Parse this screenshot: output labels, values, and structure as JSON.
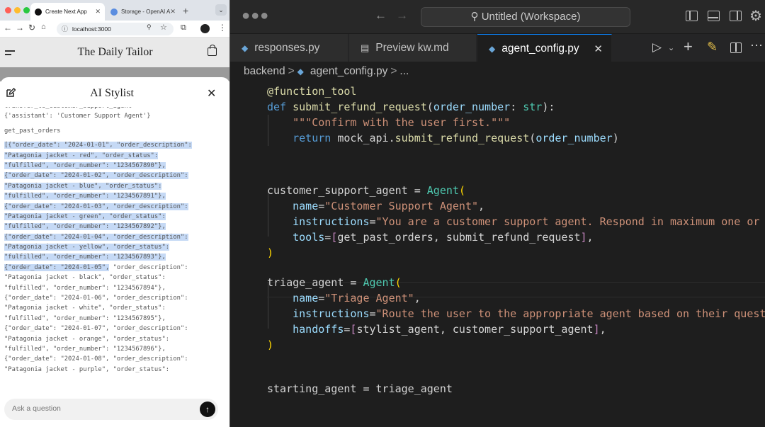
{
  "browser": {
    "tabs": [
      {
        "label": "Create Next App",
        "active": true
      },
      {
        "label": "Storage - OpenAI A",
        "active": false
      }
    ],
    "url": "localhost:3000",
    "site_title": "The Daily Tailor",
    "chat": {
      "title": "AI Stylist",
      "log": [
        {
          "text": "transfer_to_customer_support_agent",
          "cutoff": true
        },
        {
          "text": "{'assistant': 'Customer Support Agent'}"
        },
        {
          "gap": true
        },
        {
          "text": "get_past_orders"
        },
        {
          "gap": true
        },
        {
          "sel": "[{\"order_date\": \"2024-01-01\", \"order_description\":",
          "full": true
        },
        {
          "sel": "\"Patagonia jacket - red\", \"order_status\":",
          "full": true
        },
        {
          "sel": "\"fulfilled\", \"order_number\": \"1234567890\"},",
          "full": true
        },
        {
          "sel": "{\"order_date\": \"2024-01-02\", \"order_description\":",
          "full": true
        },
        {
          "sel": "\"Patagonia jacket - blue\", \"order_status\":",
          "full": true
        },
        {
          "sel": "\"fulfilled\", \"order_number\": \"1234567891\"},",
          "full": true
        },
        {
          "sel": "{\"order_date\": \"2024-01-03\", \"order_description\":",
          "full": true
        },
        {
          "sel": "\"Patagonia jacket - green\", \"order_status\":",
          "full": true
        },
        {
          "sel": "\"fulfilled\", \"order_number\": \"1234567892\"},",
          "full": true
        },
        {
          "sel": "{\"order_date\": \"2024-01-04\", \"order_description\":",
          "full": true
        },
        {
          "sel": "\"Patagonia jacket - yellow\", \"order_status\":",
          "full": true
        },
        {
          "sel": "\"fulfilled\", \"order_number\": \"1234567893\"},",
          "full": true
        },
        {
          "sel": "{\"order_date\": \"2024-01-05\",",
          "rest": " \"order_description\":"
        },
        {
          "text": "\"Patagonia jacket - black\", \"order_status\":"
        },
        {
          "text": "\"fulfilled\", \"order_number\": \"1234567894\"},"
        },
        {
          "text": "{\"order_date\": \"2024-01-06\", \"order_description\":"
        },
        {
          "text": "\"Patagonia jacket - white\", \"order_status\":"
        },
        {
          "text": "\"fulfilled\", \"order_number\": \"1234567895\"},"
        },
        {
          "text": "{\"order_date\": \"2024-01-07\", \"order_description\":"
        },
        {
          "text": "\"Patagonia jacket - orange\", \"order_status\":"
        },
        {
          "text": "\"fulfilled\", \"order_number\": \"1234567896\"},"
        },
        {
          "text": "{\"order_date\": \"2024-01-08\", \"order_description\":"
        },
        {
          "text": "\"Patagonia jacket - purple\", \"order_status\":"
        }
      ],
      "input_placeholder": "Ask a question"
    },
    "colors": {
      "selection": "#c5d9f5",
      "site_header_bg": "#e9e9e9"
    }
  },
  "vscode": {
    "search_label": "Untitled (Workspace)",
    "tabs": [
      {
        "label": "responses.py",
        "icon": "python-icon"
      },
      {
        "label": "Preview kw.md",
        "icon": "preview-icon"
      },
      {
        "label": "agent_config.py",
        "icon": "python-icon",
        "active": true
      }
    ],
    "breadcrumbs": [
      "backend",
      "agent_config.py",
      "..."
    ],
    "code_lines": [
      "@function_tool",
      "def submit_refund_request(order_number: str):",
      "    \"\"\"Confirm with the user first.\"\"\"",
      "    return mock_api.submit_refund_request(order_number)",
      "",
      "",
      "customer_support_agent = Agent(",
      "    name=\"Customer Support Agent\",",
      "    instructions=\"You are a customer support agent. Respond in maximum one or two",
      "    tools=[get_past_orders, submit_refund_request],",
      ")",
      "",
      "triage_agent = Agent(",
      "    name=\"Triage Agent\",",
      "    instructions=\"Route the user to the appropriate agent based on their question.",
      "    handoffs=[stylist_agent, customer_support_agent],",
      ")",
      "",
      "",
      "starting_agent = triage_agent"
    ],
    "colors": {
      "keyword": "#569cd6",
      "function": "#dcdcaa",
      "param": "#9cdcfe",
      "string": "#ce9178",
      "class": "#4ec9b0"
    }
  }
}
